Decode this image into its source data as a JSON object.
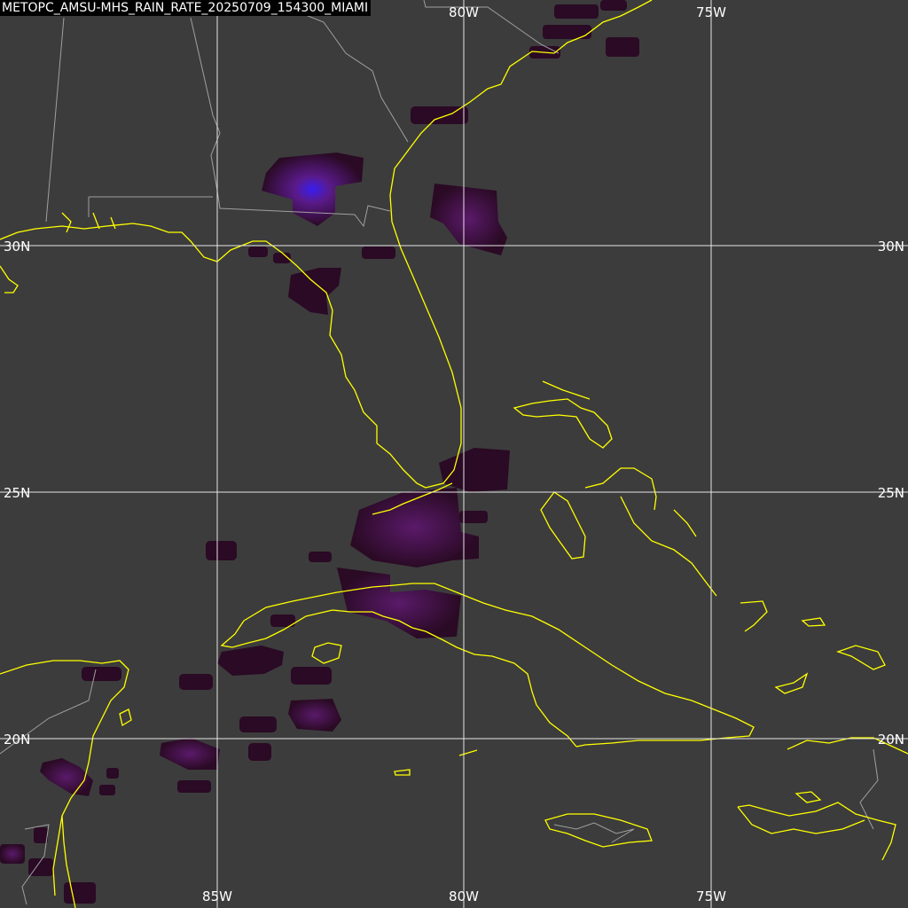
{
  "title": "METOPC_AMSU-MHS_RAIN_RATE_20250709_154300_MIAMI",
  "grid": {
    "lon_labels_top": [
      "80W",
      "75W"
    ],
    "lon_labels_bottom": [
      "85W",
      "80W",
      "75W"
    ],
    "lat_labels_left": [
      "30N",
      "25N",
      "20N"
    ],
    "lat_labels_right": [
      "30N",
      "25N",
      "20N"
    ]
  },
  "colors": {
    "background": "#3c3c3c",
    "coastline": "#ffff00",
    "borders": "#a0a0a0",
    "gridlines": "#e6e6e6",
    "rain_low": "#2a0a24",
    "rain_mid": "#5a1a6a",
    "rain_high": "#3a1ef0"
  }
}
